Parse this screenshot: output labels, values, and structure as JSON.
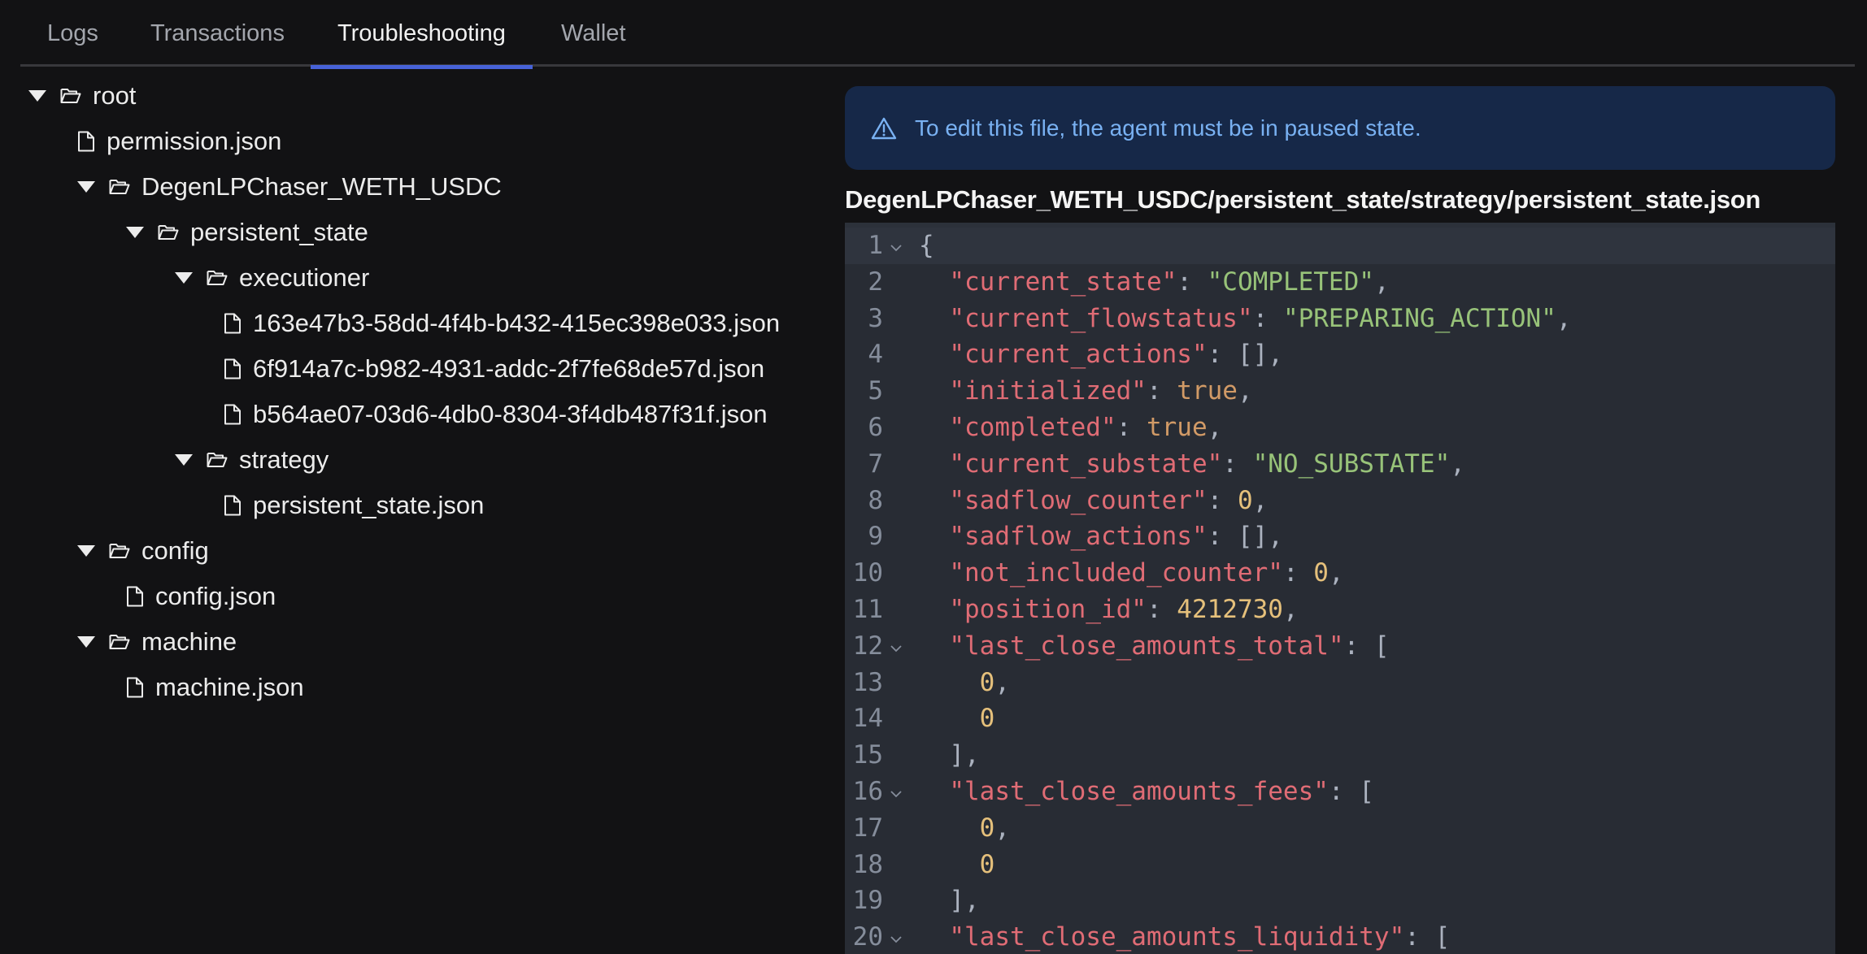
{
  "tabs": [
    {
      "label": "Logs",
      "active": false
    },
    {
      "label": "Transactions",
      "active": false
    },
    {
      "label": "Troubleshooting",
      "active": true
    },
    {
      "label": "Wallet",
      "active": false
    }
  ],
  "tree": [
    {
      "type": "folder",
      "name": "root",
      "depth": 0,
      "expanded": true
    },
    {
      "type": "file",
      "name": "permission.json",
      "depth": 1
    },
    {
      "type": "folder",
      "name": "DegenLPChaser_WETH_USDC",
      "depth": 1,
      "expanded": true
    },
    {
      "type": "folder",
      "name": "persistent_state",
      "depth": 2,
      "expanded": true
    },
    {
      "type": "folder",
      "name": "executioner",
      "depth": 3,
      "expanded": true
    },
    {
      "type": "file",
      "name": "163e47b3-58dd-4f4b-b432-415ec398e033.json",
      "depth": 4
    },
    {
      "type": "file",
      "name": "6f914a7c-b982-4931-addc-2f7fe68de57d.json",
      "depth": 4
    },
    {
      "type": "file",
      "name": "b564ae07-03d6-4db0-8304-3f4db487f31f.json",
      "depth": 4
    },
    {
      "type": "folder",
      "name": "strategy",
      "depth": 3,
      "expanded": true
    },
    {
      "type": "file",
      "name": "persistent_state.json",
      "depth": 4
    },
    {
      "type": "folder",
      "name": "config",
      "depth": 1,
      "expanded": true
    },
    {
      "type": "file",
      "name": "config.json",
      "depth": 2
    },
    {
      "type": "folder",
      "name": "machine",
      "depth": 1,
      "expanded": true
    },
    {
      "type": "file",
      "name": "machine.json",
      "depth": 2
    }
  ],
  "banner": {
    "icon": "warning-icon",
    "message": "To edit this file, the agent must be in paused state."
  },
  "editor": {
    "file_path": "DegenLPChaser_WETH_USDC/persistent_state/strategy/persistent_state.json",
    "active_line": 1,
    "lines": [
      {
        "n": "1",
        "fold": true,
        "tokens": [
          [
            "p",
            "{"
          ]
        ]
      },
      {
        "n": "2",
        "tokens": [
          [
            "p",
            "  "
          ],
          [
            "k",
            "\"current_state\""
          ],
          [
            "p",
            ": "
          ],
          [
            "s",
            "\"COMPLETED\""
          ],
          [
            "p",
            ","
          ]
        ]
      },
      {
        "n": "3",
        "tokens": [
          [
            "p",
            "  "
          ],
          [
            "k",
            "\"current_flowstatus\""
          ],
          [
            "p",
            ": "
          ],
          [
            "s",
            "\"PREPARING_ACTION\""
          ],
          [
            "p",
            ","
          ]
        ]
      },
      {
        "n": "4",
        "tokens": [
          [
            "p",
            "  "
          ],
          [
            "k",
            "\"current_actions\""
          ],
          [
            "p",
            ": [],"
          ]
        ]
      },
      {
        "n": "5",
        "tokens": [
          [
            "p",
            "  "
          ],
          [
            "k",
            "\"initialized\""
          ],
          [
            "p",
            ": "
          ],
          [
            "b",
            "true"
          ],
          [
            "p",
            ","
          ]
        ]
      },
      {
        "n": "6",
        "tokens": [
          [
            "p",
            "  "
          ],
          [
            "k",
            "\"completed\""
          ],
          [
            "p",
            ": "
          ],
          [
            "b",
            "true"
          ],
          [
            "p",
            ","
          ]
        ]
      },
      {
        "n": "7",
        "tokens": [
          [
            "p",
            "  "
          ],
          [
            "k",
            "\"current_substate\""
          ],
          [
            "p",
            ": "
          ],
          [
            "s",
            "\"NO_SUBSTATE\""
          ],
          [
            "p",
            ","
          ]
        ]
      },
      {
        "n": "8",
        "tokens": [
          [
            "p",
            "  "
          ],
          [
            "k",
            "\"sadflow_counter\""
          ],
          [
            "p",
            ": "
          ],
          [
            "n",
            "0"
          ],
          [
            "p",
            ","
          ]
        ]
      },
      {
        "n": "9",
        "tokens": [
          [
            "p",
            "  "
          ],
          [
            "k",
            "\"sadflow_actions\""
          ],
          [
            "p",
            ": [],"
          ]
        ]
      },
      {
        "n": "10",
        "tokens": [
          [
            "p",
            "  "
          ],
          [
            "k",
            "\"not_included_counter\""
          ],
          [
            "p",
            ": "
          ],
          [
            "n",
            "0"
          ],
          [
            "p",
            ","
          ]
        ]
      },
      {
        "n": "11",
        "tokens": [
          [
            "p",
            "  "
          ],
          [
            "k",
            "\"position_id\""
          ],
          [
            "p",
            ": "
          ],
          [
            "n",
            "4212730"
          ],
          [
            "p",
            ","
          ]
        ]
      },
      {
        "n": "12",
        "fold": true,
        "tokens": [
          [
            "p",
            "  "
          ],
          [
            "k",
            "\"last_close_amounts_total\""
          ],
          [
            "p",
            ": ["
          ]
        ]
      },
      {
        "n": "13",
        "tokens": [
          [
            "p",
            "    "
          ],
          [
            "n",
            "0"
          ],
          [
            "p",
            ","
          ]
        ]
      },
      {
        "n": "14",
        "tokens": [
          [
            "p",
            "    "
          ],
          [
            "n",
            "0"
          ]
        ]
      },
      {
        "n": "15",
        "tokens": [
          [
            "p",
            "  ],"
          ]
        ]
      },
      {
        "n": "16",
        "fold": true,
        "tokens": [
          [
            "p",
            "  "
          ],
          [
            "k",
            "\"last_close_amounts_fees\""
          ],
          [
            "p",
            ": ["
          ]
        ]
      },
      {
        "n": "17",
        "tokens": [
          [
            "p",
            "    "
          ],
          [
            "n",
            "0"
          ],
          [
            "p",
            ","
          ]
        ]
      },
      {
        "n": "18",
        "tokens": [
          [
            "p",
            "    "
          ],
          [
            "n",
            "0"
          ]
        ]
      },
      {
        "n": "19",
        "tokens": [
          [
            "p",
            "  ],"
          ]
        ]
      },
      {
        "n": "20",
        "fold": true,
        "tokens": [
          [
            "p",
            "  "
          ],
          [
            "k",
            "\"last_close_amounts_liquidity\""
          ],
          [
            "p",
            ": ["
          ]
        ]
      }
    ]
  },
  "colors": {
    "accent": "#4762d8",
    "banner_bg": "#162848",
    "banner_text": "#79b1f2",
    "json_key": "#e06c75",
    "json_string": "#98c379",
    "json_number": "#e5c07b",
    "json_boolean": "#d19a66"
  }
}
